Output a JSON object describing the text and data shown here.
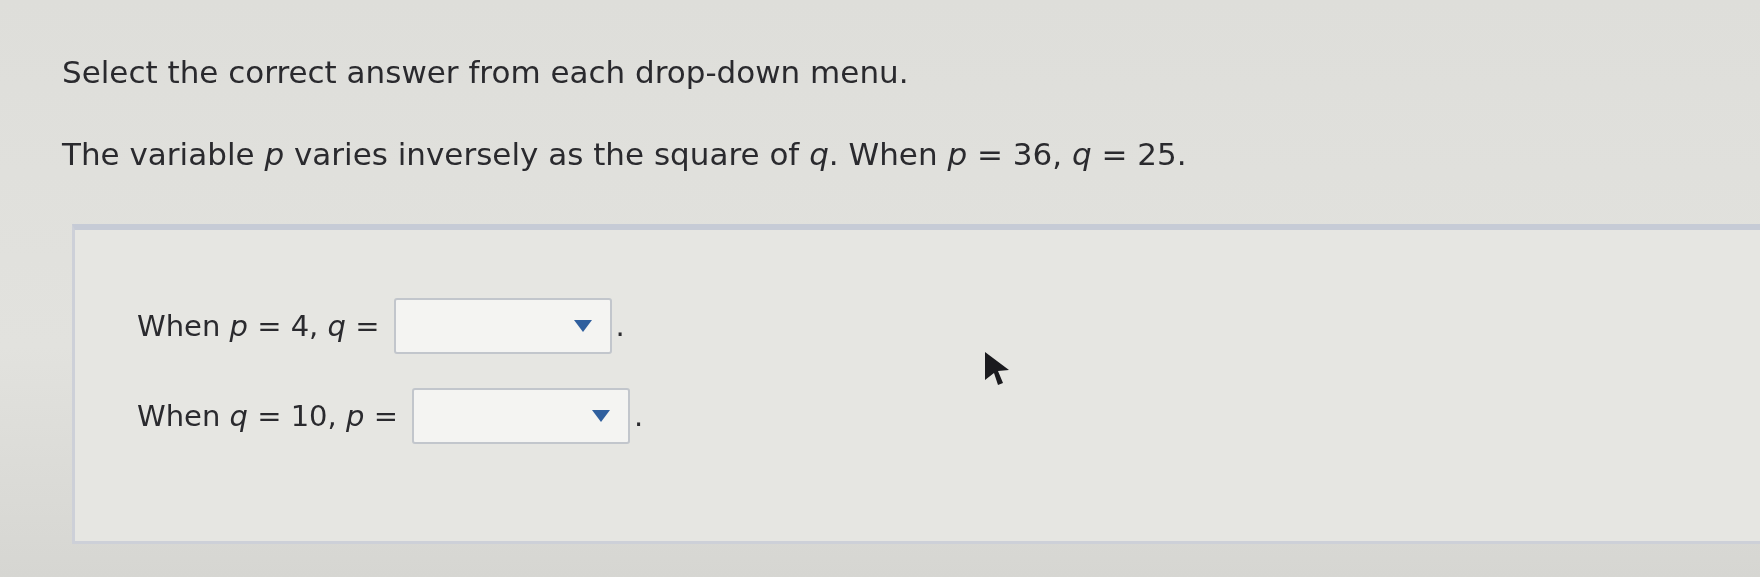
{
  "instruction": "Select the correct answer from each drop-down menu.",
  "question": "The variable *p* varies inversely as the square of *q*. When *p* = 36, *q* = 25.",
  "answers": [
    {
      "prefix": "When *p* = 4, *q* =",
      "suffix": "."
    },
    {
      "prefix": "When *q* = 10, *p* =",
      "suffix": "."
    }
  ]
}
